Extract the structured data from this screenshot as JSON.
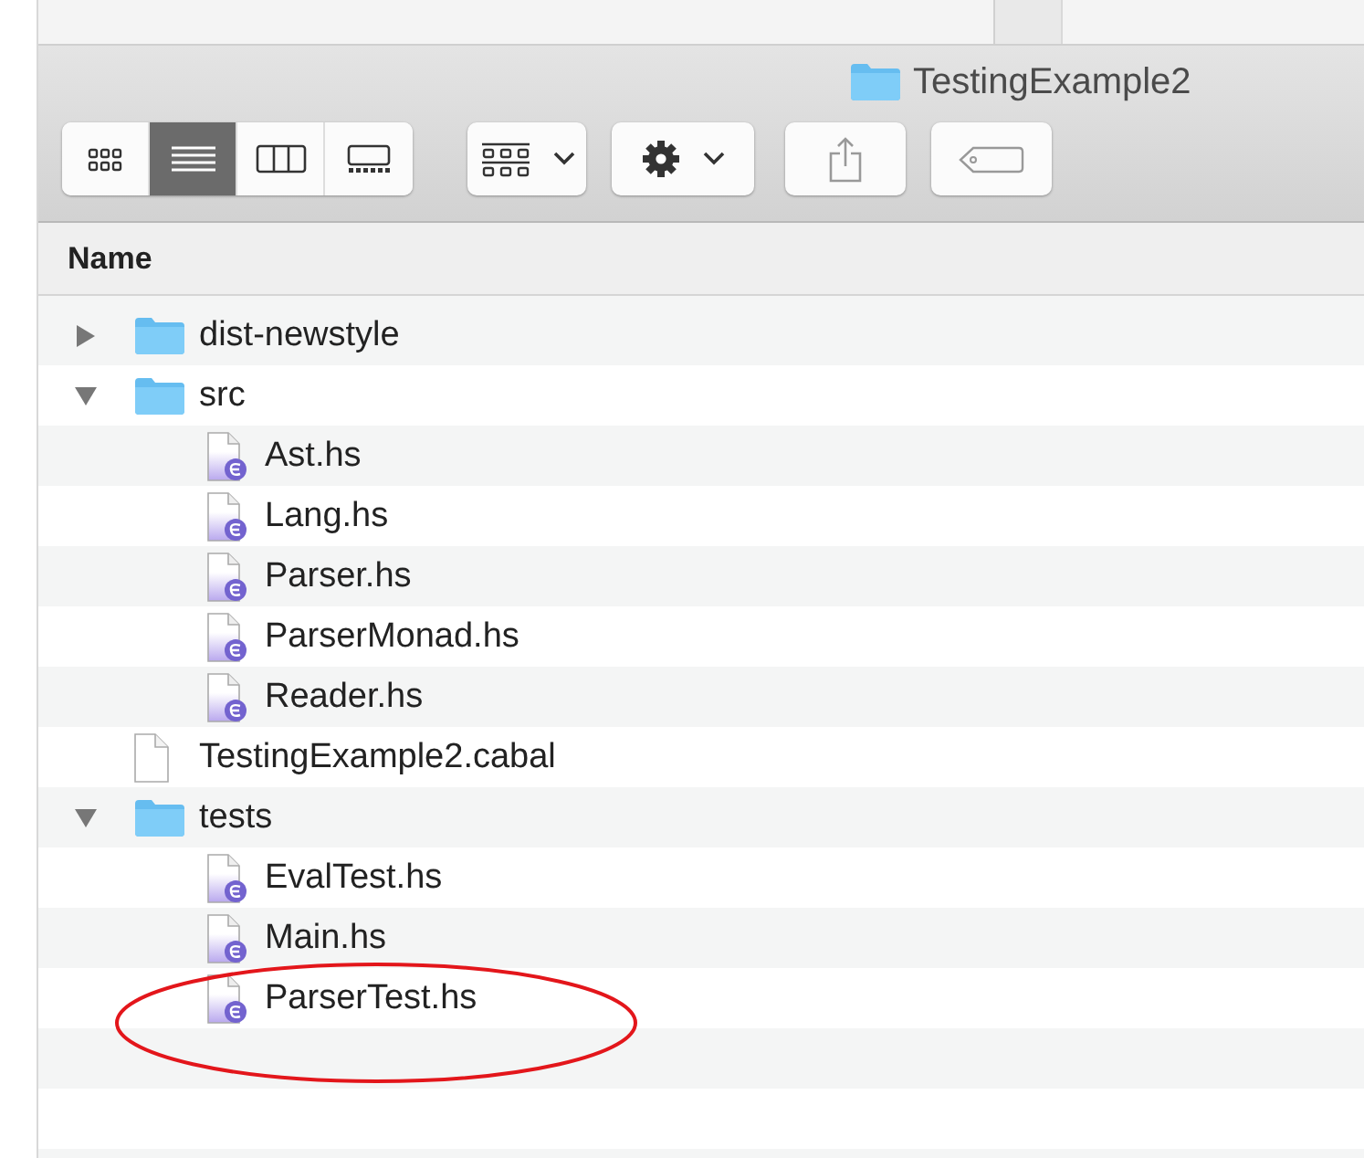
{
  "window": {
    "title": "TestingExample2"
  },
  "toolbar": {
    "view_modes": [
      {
        "kind": "icons",
        "selected": false
      },
      {
        "kind": "list",
        "selected": true
      },
      {
        "kind": "columns",
        "selected": false
      },
      {
        "kind": "gallery",
        "selected": false
      }
    ],
    "buttons": [
      {
        "kind": "group",
        "menu": true
      },
      {
        "kind": "action",
        "menu": true
      },
      {
        "kind": "share",
        "menu": false
      },
      {
        "kind": "tags",
        "menu": false
      }
    ]
  },
  "columns": [
    "Name"
  ],
  "files": [
    {
      "name": "dist-newstyle",
      "kind": "folder",
      "expanded": false
    },
    {
      "name": "src",
      "kind": "folder",
      "expanded": true,
      "children": [
        {
          "name": "Ast.hs",
          "kind": "haskell"
        },
        {
          "name": "Lang.hs",
          "kind": "haskell"
        },
        {
          "name": "Parser.hs",
          "kind": "haskell"
        },
        {
          "name": "ParserMonad.hs",
          "kind": "haskell"
        },
        {
          "name": "Reader.hs",
          "kind": "haskell"
        }
      ]
    },
    {
      "name": "TestingExample2.cabal",
      "kind": "file"
    },
    {
      "name": "tests",
      "kind": "folder",
      "expanded": true,
      "children": [
        {
          "name": "EvalTest.hs",
          "kind": "haskell"
        },
        {
          "name": "Main.hs",
          "kind": "haskell"
        },
        {
          "name": "ParserTest.hs",
          "kind": "haskell",
          "circled": true
        }
      ]
    }
  ]
}
